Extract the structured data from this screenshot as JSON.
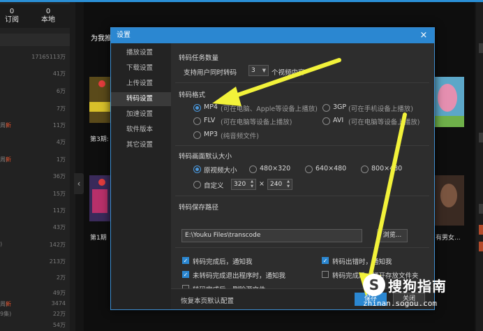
{
  "app": {
    "counts": [
      {
        "num": "0",
        "label": "订阅"
      },
      {
        "num": "0",
        "label": "本地"
      }
    ],
    "left_rows": [
      {
        "left": "",
        "new": "",
        "value": "17165113万"
      },
      {
        "left": "",
        "new": "",
        "value": "41万"
      },
      {
        "left": "",
        "new": "",
        "value": "6万"
      },
      {
        "left": "",
        "new": "",
        "value": "7万"
      },
      {
        "left": "周)",
        "new": "新",
        "value": "11万"
      },
      {
        "left": "",
        "new": "",
        "value": "4万"
      },
      {
        "left": "周)",
        "new": "新",
        "value": "1万"
      },
      {
        "left": "",
        "new": "",
        "value": "36万"
      },
      {
        "left": "",
        "new": "",
        "value": "15万"
      },
      {
        "left": "",
        "new": "",
        "value": "11万"
      },
      {
        "left": "",
        "new": "",
        "value": "43万"
      },
      {
        "left": ")",
        "new": "",
        "value": "142万"
      },
      {
        "left": "",
        "new": "",
        "value": "213万"
      },
      {
        "left": "",
        "new": "",
        "value": "2万"
      },
      {
        "left": "",
        "new": "",
        "value": "49万"
      },
      {
        "left": "周)",
        "new": "新",
        "value": "3474"
      },
      {
        "left": "9集)",
        "new": "",
        "value": "22万"
      },
      {
        "left": "",
        "new": "",
        "value": "54万"
      }
    ],
    "section_title": "为我推",
    "thumb_captions": [
      "第3期:",
      "第1期",
      "有男女..."
    ]
  },
  "dialog": {
    "title": "设置",
    "close_glyph": "×",
    "nav": [
      {
        "label": "播放设置",
        "active": false
      },
      {
        "label": "下载设置",
        "active": false
      },
      {
        "label": "上传设置",
        "active": false
      },
      {
        "label": "转码设置",
        "active": true
      },
      {
        "label": "加速设置",
        "active": false
      },
      {
        "label": "软件版本",
        "active": false
      },
      {
        "label": "其它设置",
        "active": false
      }
    ],
    "tasks": {
      "heading": "转码任务数量",
      "prefix": "支持用户同时转码",
      "value": "3",
      "suffix": "个视频内容"
    },
    "format": {
      "heading": "转码格式",
      "options": [
        {
          "name": "MP4",
          "hint": "(可在电脑、Apple等设备上播放)",
          "selected": true
        },
        {
          "name": "3GP",
          "hint": "(可在手机设备上播放)",
          "selected": false
        },
        {
          "name": "FLV",
          "hint": "(可在电脑等设备上播放)",
          "selected": false
        },
        {
          "name": "AVI",
          "hint": "(可在电脑等设备上播放)",
          "selected": false
        },
        {
          "name": "MP3",
          "hint": "(纯音频文件)",
          "selected": false
        }
      ]
    },
    "size": {
      "heading": "转码画面默认大小",
      "options": [
        {
          "label": "原视频大小",
          "selected": true
        },
        {
          "label": "480×320",
          "selected": false
        },
        {
          "label": "640×480",
          "selected": false
        },
        {
          "label": "800×480",
          "selected": false
        }
      ],
      "custom_label": "自定义",
      "custom_width": "320",
      "times": "×",
      "custom_height": "240"
    },
    "path": {
      "heading": "转码保存路径",
      "value": "E:\\Youku Files\\transcode",
      "browse_label": "浏览..."
    },
    "checks": [
      {
        "label": "转码完成后，通知我",
        "checked": true
      },
      {
        "label": "转码出错时，通知我",
        "checked": true
      },
      {
        "label": "未转码完成退出程序时，通知我",
        "checked": true
      },
      {
        "label": "转码完成后，打开存放文件夹",
        "checked": false
      },
      {
        "label": "转码完成后，删除源文件",
        "checked": false
      }
    ],
    "footer": {
      "reset_label": "恢复本页默认配置",
      "save_label": "保存",
      "close_label": "关闭"
    }
  },
  "watermark": {
    "logo_glyph": "S",
    "brand": "搜狗指南",
    "url": "zhinan.sogou.com"
  },
  "colors": {
    "accent": "#2b87d1",
    "annotation": "#f2f23a",
    "new_badge": "#e2502b"
  }
}
